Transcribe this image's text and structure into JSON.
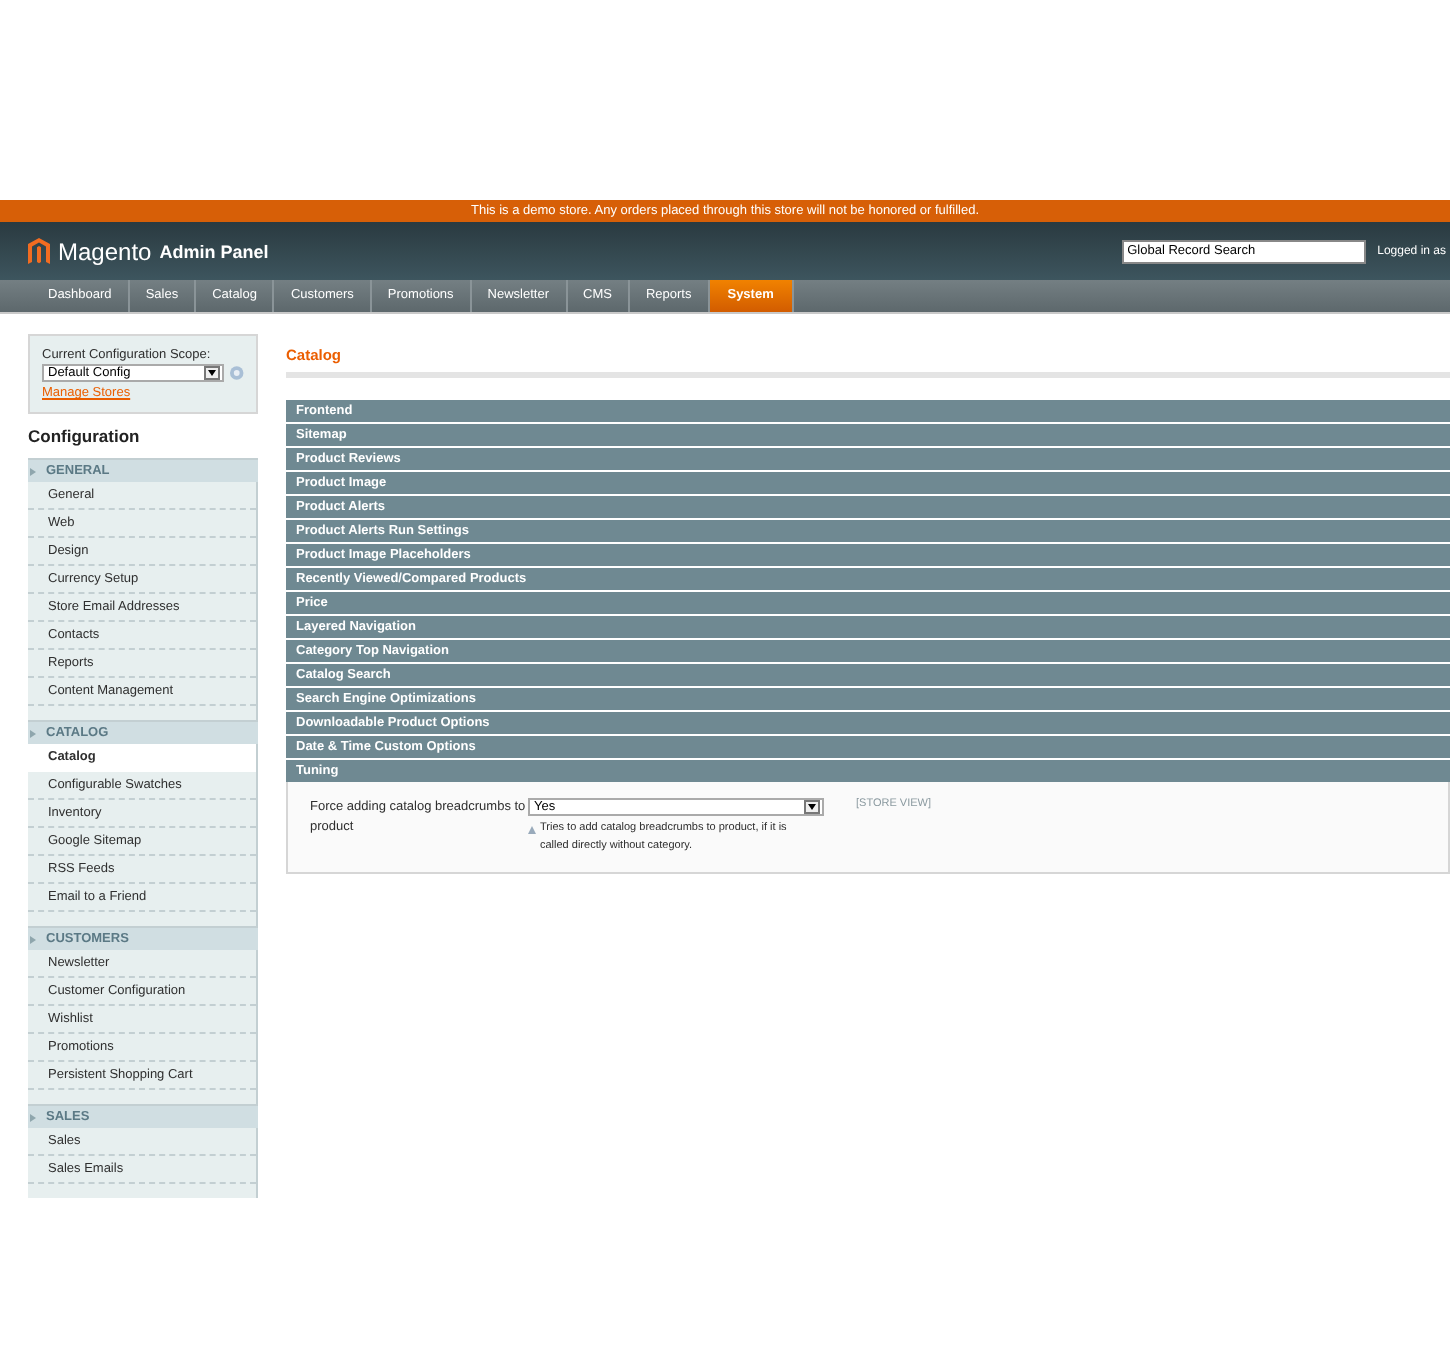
{
  "notice": "This is a demo store. Any orders placed through this store will not be honored or fulfilled.",
  "header": {
    "logo_text": "Magento",
    "logo_sub": "Admin Panel",
    "search": {
      "value": "Global Record Search"
    },
    "user_text": "Logged in as"
  },
  "nav": [
    {
      "label": "Dashboard",
      "selected": false
    },
    {
      "label": "Sales",
      "selected": false
    },
    {
      "label": "Catalog",
      "selected": false
    },
    {
      "label": "Customers",
      "selected": false
    },
    {
      "label": "Promotions",
      "selected": false
    },
    {
      "label": "Newsletter",
      "selected": false
    },
    {
      "label": "CMS",
      "selected": false
    },
    {
      "label": "Reports",
      "selected": false
    },
    {
      "label": "System",
      "selected": true
    }
  ],
  "scope": {
    "label": "Current Configuration Scope:",
    "value": "Default Config",
    "link": "Manage Stores"
  },
  "sidebar": {
    "title": "Configuration",
    "groups": [
      {
        "heading": "GENERAL",
        "items": [
          {
            "label": "General",
            "selected": false
          },
          {
            "label": "Web",
            "selected": false
          },
          {
            "label": "Design",
            "selected": false
          },
          {
            "label": "Currency Setup",
            "selected": false
          },
          {
            "label": "Store Email Addresses",
            "selected": false
          },
          {
            "label": "Contacts",
            "selected": false
          },
          {
            "label": "Reports",
            "selected": false
          },
          {
            "label": "Content Management",
            "selected": false
          }
        ]
      },
      {
        "heading": "CATALOG",
        "items": [
          {
            "label": "Catalog",
            "selected": true
          },
          {
            "label": "Configurable Swatches",
            "selected": false
          },
          {
            "label": "Inventory",
            "selected": false
          },
          {
            "label": "Google Sitemap",
            "selected": false
          },
          {
            "label": "RSS Feeds",
            "selected": false
          },
          {
            "label": "Email to a Friend",
            "selected": false
          }
        ]
      },
      {
        "heading": "CUSTOMERS",
        "items": [
          {
            "label": "Newsletter",
            "selected": false
          },
          {
            "label": "Customer Configuration",
            "selected": false
          },
          {
            "label": "Wishlist",
            "selected": false
          },
          {
            "label": "Promotions",
            "selected": false
          },
          {
            "label": "Persistent Shopping Cart",
            "selected": false
          }
        ]
      },
      {
        "heading": "SALES",
        "items": [
          {
            "label": "Sales",
            "selected": false
          },
          {
            "label": "Sales Emails",
            "selected": false
          }
        ]
      }
    ]
  },
  "main": {
    "title": "Catalog",
    "sections": [
      {
        "label": "Frontend",
        "expanded": false
      },
      {
        "label": "Sitemap",
        "expanded": false
      },
      {
        "label": "Product Reviews",
        "expanded": false
      },
      {
        "label": "Product Image",
        "expanded": false
      },
      {
        "label": "Product Alerts",
        "expanded": false
      },
      {
        "label": "Product Alerts Run Settings",
        "expanded": false
      },
      {
        "label": "Product Image Placeholders",
        "expanded": false
      },
      {
        "label": "Recently Viewed/Compared Products",
        "expanded": false
      },
      {
        "label": "Price",
        "expanded": false
      },
      {
        "label": "Layered Navigation",
        "expanded": false
      },
      {
        "label": "Category Top Navigation",
        "expanded": false
      },
      {
        "label": "Catalog Search",
        "expanded": false
      },
      {
        "label": "Search Engine Optimizations",
        "expanded": false
      },
      {
        "label": "Downloadable Product Options",
        "expanded": false
      },
      {
        "label": "Date & Time Custom Options",
        "expanded": false
      },
      {
        "label": "Tuning",
        "expanded": true,
        "fields": [
          {
            "label": "Force adding catalog breadcrumbs to product",
            "value": "Yes",
            "hint": "Tries to add catalog breadcrumbs to product, if it is called directly without category.",
            "scope": "[STORE VIEW]"
          }
        ]
      }
    ]
  }
}
